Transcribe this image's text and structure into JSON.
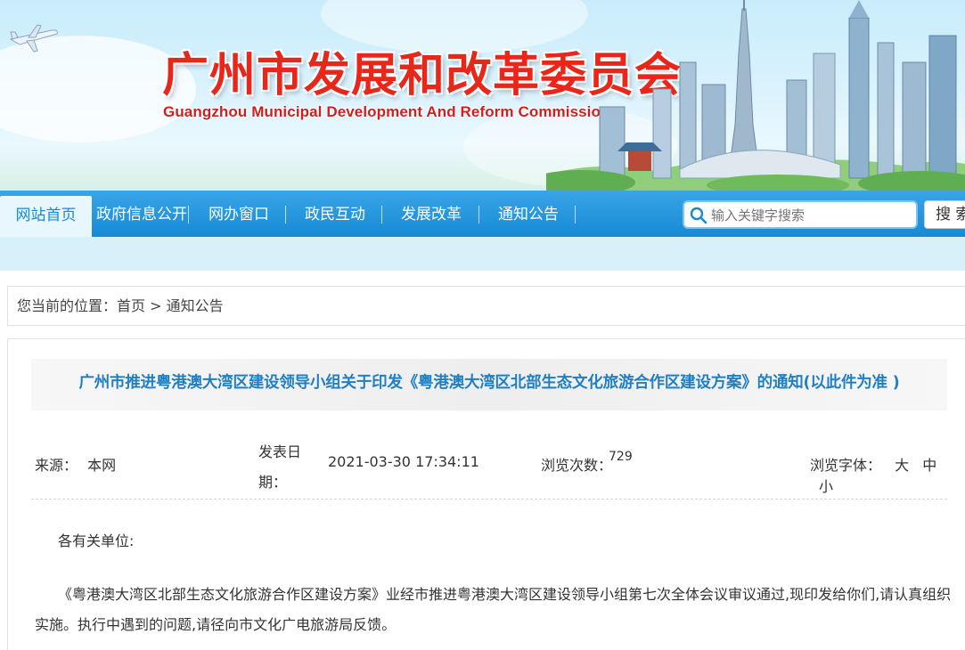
{
  "banner": {
    "title_cn": "广州市发展和改革委员会",
    "title_en": "Guangzhou Municipal Development And Reform Commission"
  },
  "nav": {
    "items": [
      {
        "label": "网站首页",
        "active": true
      },
      {
        "label": "政府信息公开",
        "active": false
      },
      {
        "label": "网办窗口",
        "active": false
      },
      {
        "label": "政民互动",
        "active": false
      },
      {
        "label": "发展改革",
        "active": false
      },
      {
        "label": "通知公告",
        "active": false
      }
    ],
    "search_placeholder": "输入关键字搜索",
    "search_button": "搜 索"
  },
  "breadcrumb": {
    "prefix": "您当前的位置：",
    "home": "首页",
    "separator": ">",
    "current": "通知公告"
  },
  "article": {
    "title": "广州市推进粤港澳大湾区建设领导小组关于印发《粤港澳大湾区北部生态文化旅游合作区建设方案》的通知(以此件为准 )",
    "source_label": "来源：",
    "source_value": "本网",
    "date_label": "发表日期：",
    "date_value": "2021-03-30 17:34:11",
    "views_label": "浏览次数：",
    "views_value": "729",
    "font_label": "浏览字体：",
    "font_options": [
      "大",
      "中",
      "小"
    ],
    "greeting": "各有关单位:",
    "paragraph": "《粤港澳大湾区北部生态文化旅游合作区建设方案》业经市推进粤港澳大湾区建设领导小组第七次全体会议审议通过,现印发给你们,请认真组织实施。执行中遇到的问题,请径向市文化广电旅游局反馈。"
  },
  "colors": {
    "nav_blue": "#168ad6",
    "title_red": "#e8271a",
    "article_title_blue": "#1f7fc2"
  }
}
